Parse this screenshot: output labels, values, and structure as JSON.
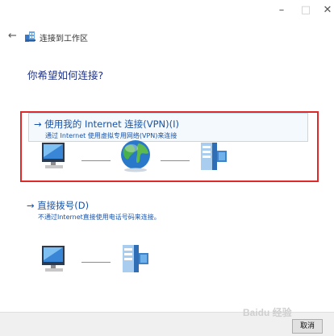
{
  "window": {
    "minimize_glyph": "–",
    "maximize_glyph": "□",
    "close_glyph": "✕"
  },
  "nav": {
    "back_glyph": "←",
    "title": "连接到工作区",
    "icon": "connect-workplace-icon"
  },
  "main": {
    "question": "你希望如何连接?"
  },
  "options": [
    {
      "title": "→ 使用我的 Internet 连接(VPN)(I)",
      "description": "通过 Internet 使用虚拟专用网络(VPN)来连接",
      "icons": [
        "computer-icon",
        "globe-icon",
        "server-icon"
      ]
    },
    {
      "title": "→ 直接拨号(D)",
      "description": "不通过Internet直接使用电话号码来连接。",
      "icons": [
        "computer-icon",
        "server-icon"
      ]
    }
  ],
  "footer": {
    "cancel_label": "取消",
    "watermark": "Baidu 经验"
  },
  "colors": {
    "accent": "#1b53a6",
    "question": "#1e3287",
    "highlight_border": "#e02a2a",
    "selected_bg": "#f3f9fd"
  }
}
